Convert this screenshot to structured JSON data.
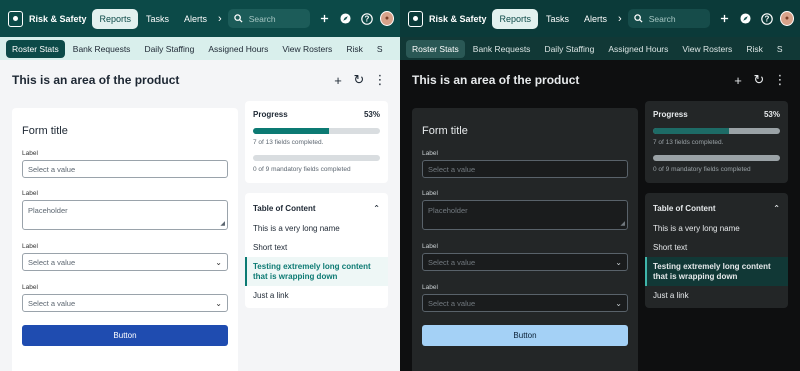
{
  "panes": [
    {
      "theme": "light",
      "nav": {
        "app_name": "Risk & Safety",
        "tabs": [
          {
            "label": "Reports",
            "active": true
          },
          {
            "label": "Tasks",
            "active": false
          },
          {
            "label": "Alerts",
            "active": false
          }
        ],
        "search_placeholder": "Search"
      },
      "subnav": [
        "Roster Stats",
        "Bank Requests",
        "Daily Staffing",
        "Assigned Hours",
        "View Rosters",
        "Risk",
        "S"
      ],
      "page_title": "This is an area of the product",
      "form": {
        "title": "Form title",
        "fields": [
          {
            "label": "Label",
            "value": "Select a value"
          },
          {
            "label": "Label",
            "value": "Placeholder"
          },
          {
            "label": "Label",
            "value": "Select a value"
          },
          {
            "label": "Label",
            "value": "Select a value"
          }
        ],
        "button": "Button"
      },
      "progress": {
        "title": "Progress",
        "percent_label": "53%",
        "bar1_fraction": 0.6,
        "note1": "7 of 13 fields completed.",
        "bar2_fraction": 0.0,
        "note2": "0 of 9 mandatory fields completed"
      },
      "toc": {
        "title": "Table of Content",
        "items": [
          "This is a very long name",
          "Short text",
          "Testing extremely long content that is wrapping down",
          "Just a link"
        ],
        "active_index": 2
      }
    },
    {
      "theme": "dark",
      "nav": {
        "app_name": "Risk & Safety",
        "tabs": [
          {
            "label": "Reports",
            "active": true
          },
          {
            "label": "Tasks",
            "active": false
          },
          {
            "label": "Alerts",
            "active": false
          }
        ],
        "search_placeholder": "Search"
      },
      "subnav": [
        "Roster Stats",
        "Bank Requests",
        "Daily Staffing",
        "Assigned Hours",
        "View Rosters",
        "Risk",
        "S"
      ],
      "page_title": "This is an area of the product",
      "form": {
        "title": "Form title",
        "fields": [
          {
            "label": "Label",
            "value": "Select a value"
          },
          {
            "label": "Label",
            "value": "Placeholder"
          },
          {
            "label": "Label",
            "value": "Select a value"
          },
          {
            "label": "Label",
            "value": "Select a value"
          }
        ],
        "button": "Button"
      },
      "progress": {
        "title": "Progress",
        "percent_label": "53%",
        "bar1_fraction": 0.6,
        "note1": "7 of 13 fields completed.",
        "bar2_fraction": 0.0,
        "note2": "0 of 9 mandatory fields completed"
      },
      "toc": {
        "title": "Table of Content",
        "items": [
          "This is a very long name",
          "Short text",
          "Testing extremely long content that is wrapping down",
          "Just a link"
        ],
        "active_index": 2
      }
    }
  ]
}
